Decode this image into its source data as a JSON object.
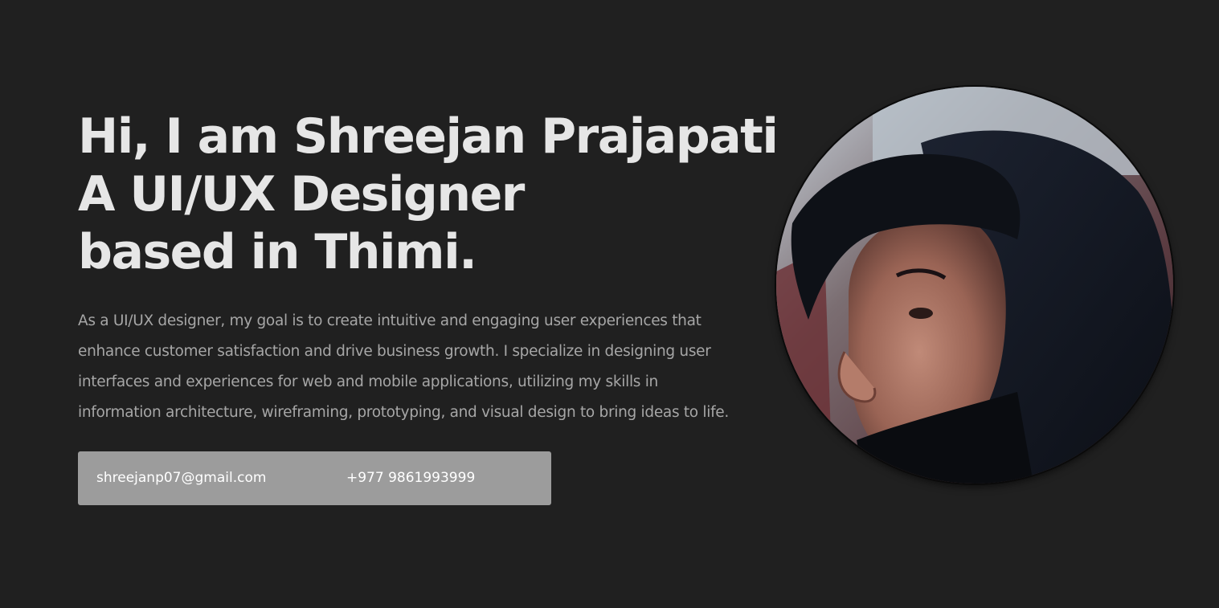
{
  "hero": {
    "heading_lines": [
      "Hi, I am Shreejan Prajapati",
      "A UI/UX Designer",
      "based in Thimi."
    ],
    "bio_lines": [
      "As a UI/UX designer, my goal is to create intuitive and engaging user experiences that",
      "enhance customer satisfaction and drive business growth. I specialize in designing user",
      "interfaces and experiences for web and mobile applications, utilizing my skills in",
      "information architecture, wireframing, prototyping, and visual design to bring ideas to life."
    ]
  },
  "contact": {
    "email": "shreejanp07@gmail.com",
    "phone": "+977 9861993999"
  },
  "colors": {
    "background": "#202020",
    "heading": "#e6e6e6",
    "bio": "#a6a6a6",
    "contact_bar": "#9c9c9c",
    "contact_text": "#ffffff"
  }
}
